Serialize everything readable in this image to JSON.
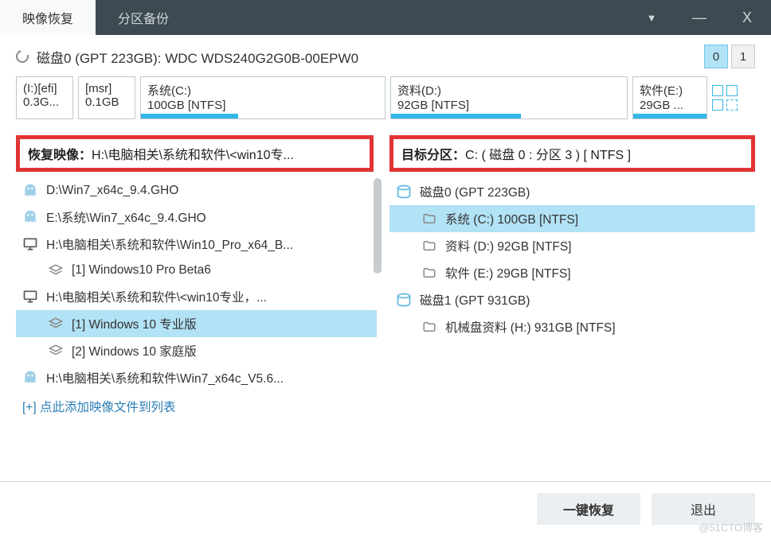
{
  "tabs": {
    "restore": "映像恢复",
    "backup": "分区备份"
  },
  "window": {
    "dropdown": "▼",
    "min": "—",
    "close": "X"
  },
  "disk": {
    "title": "磁盘0 (GPT 223GB): WDC WDS240G2G0B-00EPW0",
    "selector": [
      "0",
      "1"
    ],
    "partitions": [
      {
        "name": "(I:)[efi]",
        "size": "0.3G..."
      },
      {
        "name": "[msr]",
        "size": "0.1GB"
      },
      {
        "name": "系统(C:)",
        "size": "100GB [NTFS]"
      },
      {
        "name": "资料(D:)",
        "size": "92GB [NTFS]"
      },
      {
        "name": "软件(E:)",
        "size": "29GB ..."
      }
    ]
  },
  "left": {
    "header_label": "恢复映像：",
    "header_value": "H:\\电脑相关\\系统和软件\\<win10专...",
    "items": [
      {
        "type": "ghost",
        "indent": 0,
        "text": "D:\\Win7_x64c_9.4.GHO"
      },
      {
        "type": "ghost",
        "indent": 0,
        "text": "E:\\系统\\Win7_x64c_9.4.GHO"
      },
      {
        "type": "monitor",
        "indent": 0,
        "text": "H:\\电脑相关\\系统和软件\\Win10_Pro_x64_B..."
      },
      {
        "type": "layers",
        "indent": 1,
        "text": "[1] Windows10 Pro Beta6"
      },
      {
        "type": "monitor",
        "indent": 0,
        "text": "H:\\电脑相关\\系统和软件\\<win10专业，..."
      },
      {
        "type": "layers",
        "indent": 1,
        "text": "[1] Windows 10 专业版",
        "selected": true
      },
      {
        "type": "layers",
        "indent": 1,
        "text": "[2] Windows 10 家庭版"
      },
      {
        "type": "ghost",
        "indent": 0,
        "text": "H:\\电脑相关\\系统和软件\\Win7_x64c_V5.6..."
      }
    ],
    "add_link": "[+] 点此添加映像文件到列表"
  },
  "right": {
    "header_label": "目标分区：",
    "header_value": "C: ( 磁盘 0 : 分区 3 ) [ NTFS ]",
    "items": [
      {
        "type": "disk",
        "indent": 0,
        "text": "磁盘0 (GPT 223GB)"
      },
      {
        "type": "folder",
        "indent": 1,
        "text": "系统 (C:) 100GB [NTFS]",
        "selected": true
      },
      {
        "type": "folder",
        "indent": 1,
        "text": "资料 (D:) 92GB [NTFS]"
      },
      {
        "type": "folder",
        "indent": 1,
        "text": "软件 (E:) 29GB [NTFS]"
      },
      {
        "type": "disk",
        "indent": 0,
        "text": "磁盘1 (GPT 931GB)"
      },
      {
        "type": "folder",
        "indent": 1,
        "text": "机械盘资料 (H:) 931GB [NTFS]"
      }
    ]
  },
  "footer": {
    "restore": "一键恢复",
    "exit": "退出"
  },
  "watermark": "@51CTO博客"
}
